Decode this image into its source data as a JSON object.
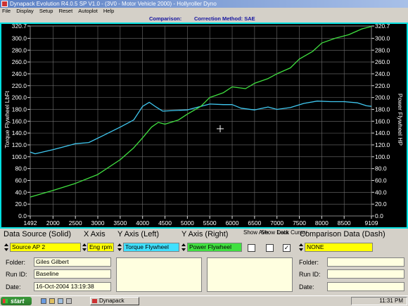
{
  "window": {
    "title": "Dynapack Evolution R4.0.5 SP V1.0 - (3V0 - Motor Vehicle 2000) - Hollyroller Dyno"
  },
  "menu": [
    "File",
    "Display",
    "Setup",
    "Reset",
    "Autoplot",
    "Help"
  ],
  "info": {
    "comparison": "Comparison:",
    "correction": "Correction Method: SAE"
  },
  "chart_data": {
    "type": "line",
    "background": "#000000",
    "border_color": "#00e0e0",
    "ylabel_left": "Torque Flywheel LbFt",
    "ylabel_right": "Power Flywheel HP",
    "x_ticks": [
      "1492",
      "2000",
      "2500",
      "3000",
      "3500",
      "4000",
      "4500",
      "5000",
      "5500",
      "6000",
      "6500",
      "7000",
      "7500",
      "8000",
      "8500",
      "9109"
    ],
    "x_tick_values": [
      1492,
      2000,
      2500,
      3000,
      3500,
      4000,
      4500,
      5000,
      5500,
      6000,
      6500,
      7000,
      7500,
      8000,
      8500,
      9109
    ],
    "y_left_ticks": [
      "320.7",
      "300.0",
      "280.0",
      "260.0",
      "240.0",
      "220.0",
      "200.0",
      "180.0",
      "160.0",
      "140.0",
      "120.0",
      "100.0",
      "80.0",
      "60.0",
      "40.0",
      "20.0",
      "0.0"
    ],
    "y_right_ticks": [
      "320.7",
      "300.0",
      "280.0",
      "260.0",
      "240.0",
      "220.0",
      "200.0",
      "180.0",
      "160.0",
      "140.0",
      "120.0",
      "100.0",
      "80.0",
      "60.0",
      "40.0",
      "20.0",
      "0.0"
    ],
    "xlim": [
      1492,
      9109
    ],
    "ylim": [
      0,
      320.7
    ],
    "series": [
      {
        "key": "torque",
        "color": "#40c8f0",
        "x": [
          1492,
          1600,
          2000,
          2300,
          2500,
          2800,
          3100,
          3500,
          3800,
          4000,
          4150,
          4300,
          4450,
          4700,
          5000,
          5200,
          5500,
          5800,
          6000,
          6200,
          6500,
          6800,
          7000,
          7300,
          7600,
          7900,
          8200,
          8500,
          8800,
          9000,
          9109
        ],
        "y": [
          108,
          105,
          112,
          118,
          122,
          124,
          135,
          150,
          162,
          185,
          192,
          184,
          177,
          178,
          179,
          183,
          189,
          188,
          188,
          182,
          179,
          184,
          180,
          183,
          190,
          194,
          193,
          193,
          191,
          186,
          185
        ]
      },
      {
        "key": "power",
        "color": "#40e040",
        "x": [
          1492,
          2000,
          2500,
          3000,
          3500,
          3800,
          4000,
          4200,
          4350,
          4500,
          4800,
          5000,
          5300,
          5500,
          5800,
          6000,
          6300,
          6500,
          6800,
          7000,
          7300,
          7500,
          7800,
          8000,
          8300,
          8600,
          8900,
          9109
        ],
        "y": [
          32,
          43,
          55,
          70,
          95,
          115,
          132,
          150,
          158,
          155,
          162,
          172,
          185,
          200,
          208,
          218,
          215,
          224,
          232,
          240,
          250,
          265,
          278,
          292,
          300,
          306,
          316,
          320
        ]
      }
    ]
  },
  "controls": {
    "data_source_label": "Data Source (Solid)",
    "x_axis_label": "X Axis",
    "y_left_label": "Y Axis (Left)",
    "y_right_label": "Y Axis (Right)",
    "show_ave_label": "Show Ave.",
    "show_data_label": "Show Data",
    "lock_cursor_label": "Lock Cursor",
    "comparison_label": "Comparison Data (Dash)",
    "source_value": "Source AP 2",
    "x_axis_value": "Eng rpm",
    "y_left_value": "Torque Flywheel",
    "y_right_value": "Power Flywheel",
    "comparison_value": "NONE",
    "show_ave_checked": false,
    "show_data_checked": false,
    "lock_cursor_checked": true
  },
  "run": {
    "folder_label": "Folder:",
    "folder": "Giles Gilbert",
    "runid_label": "Run ID:",
    "runid": "Baseline",
    "date_label": "Date:",
    "date": "16-Oct-2004 13:19:38"
  },
  "comparison": {
    "folder_label": "Folder:",
    "folder": "",
    "runid_label": "Run ID:",
    "runid": "",
    "date_label": "Date:",
    "date": ""
  },
  "taskbar": {
    "start": "start",
    "task": "Dynapack",
    "clock": "11:31 PM"
  }
}
